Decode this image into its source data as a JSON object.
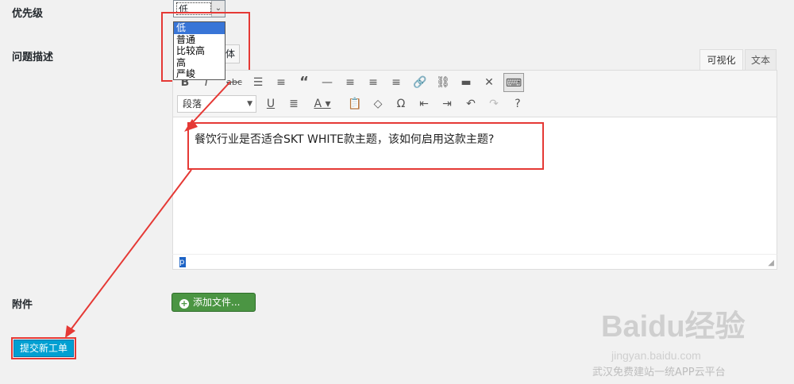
{
  "form": {
    "priority_label": "优先级",
    "priority_selected": "低",
    "priority_options": [
      "低",
      "普通",
      "比较高",
      "高",
      "严峻"
    ],
    "description_label": "问题描述",
    "attachment_label": "附件",
    "add_file_label": "添加文件...",
    "submit_label": "提交新工单"
  },
  "editor": {
    "tab_visual": "可视化",
    "tab_text": "文本",
    "partial_button_text": "体",
    "format_select": "段落",
    "content": "餐饮行业是否适合SKT WHITE款主题，该如何启用这款主题?",
    "path": "p",
    "toolbar_icons": [
      "bold-icon",
      "italic-icon",
      "strikethrough-icon",
      "bullet-list-icon",
      "numbered-list-icon",
      "blockquote-icon",
      "horizontal-rule-icon",
      "align-left-icon",
      "align-center-icon",
      "align-right-icon",
      "link-icon",
      "unlink-icon",
      "read-more-icon",
      "fullscreen-icon",
      "toolbar-toggle-icon",
      "underline-icon",
      "justify-icon",
      "text-color-icon",
      "paste-text-icon",
      "clear-format-icon",
      "special-char-icon",
      "outdent-icon",
      "indent-icon",
      "undo-icon",
      "redo-icon",
      "help-icon"
    ]
  },
  "watermark": {
    "logo": "Baidu经验",
    "url": "jingyan.baidu.com",
    "caption": "武汉免费建站一统APP云平台"
  },
  "colors": {
    "annotation": "#e53935",
    "submit": "#00a0d2",
    "add_file": "#4b9543",
    "dropdown_selected": "#3875d7"
  }
}
